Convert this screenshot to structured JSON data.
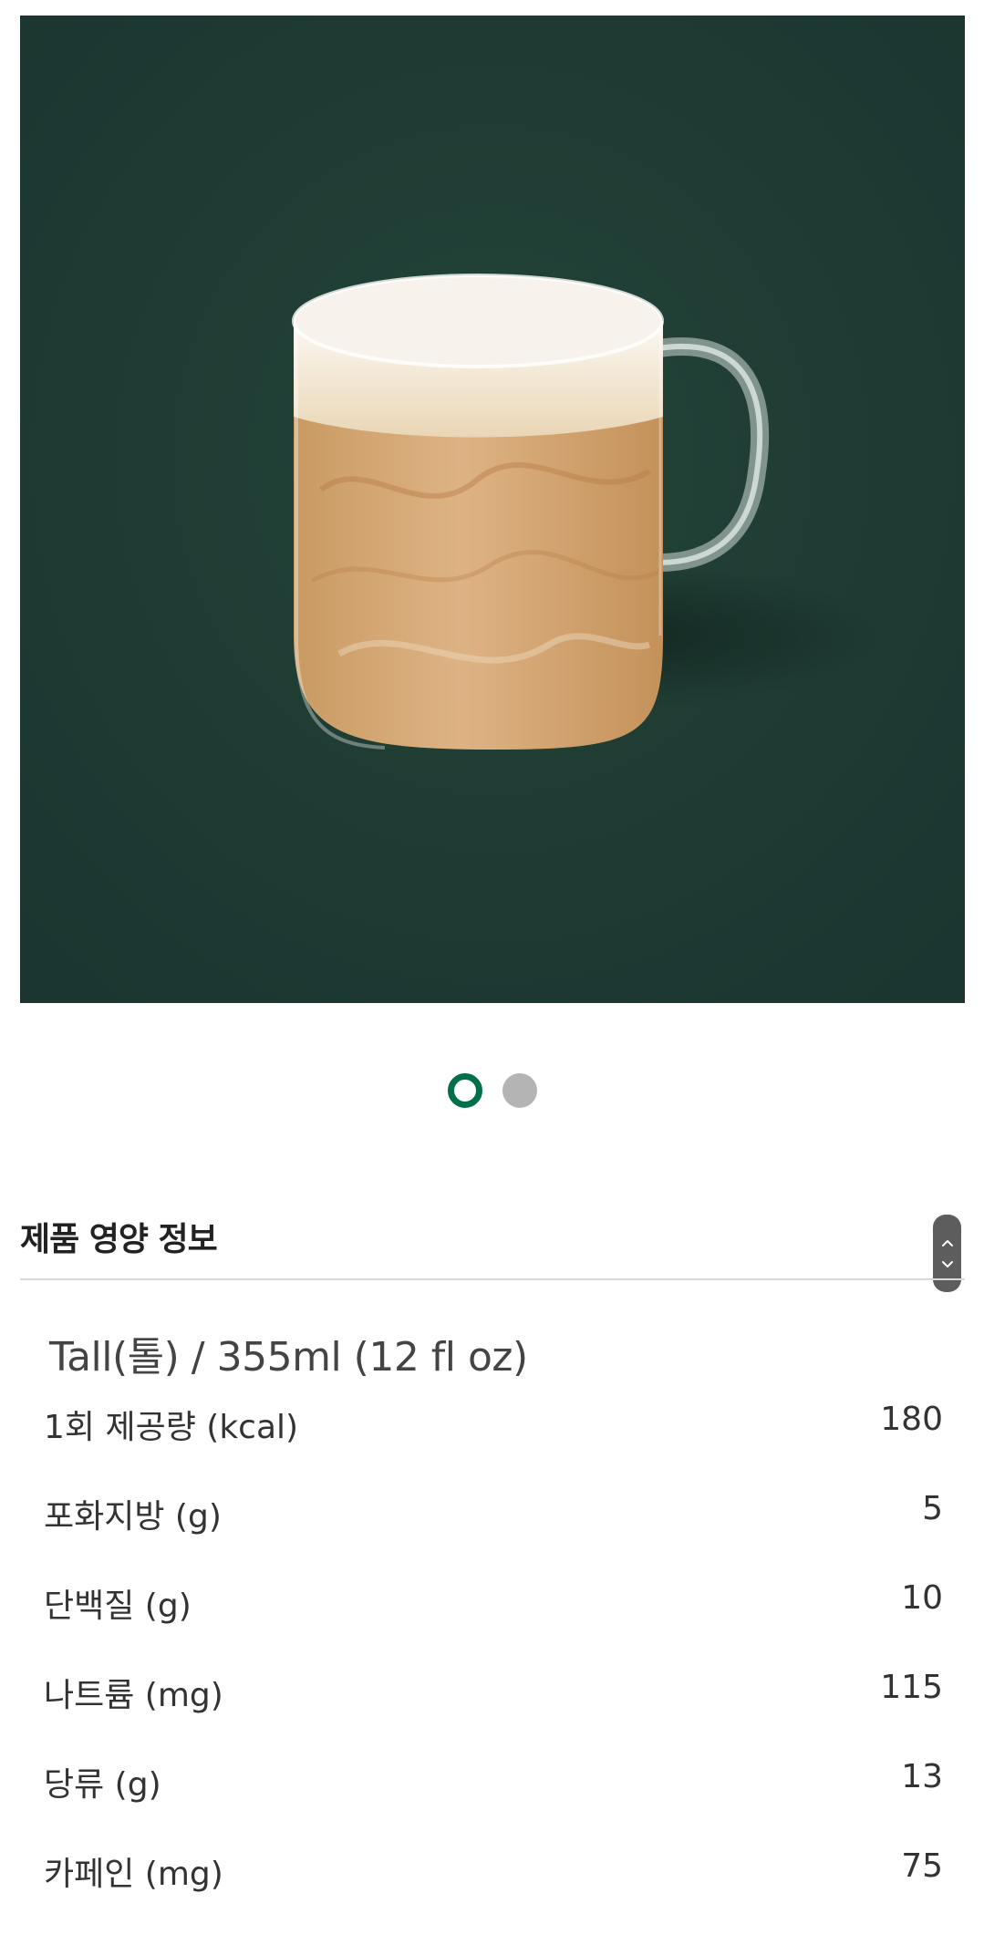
{
  "product": {
    "image_label": "drink-photo",
    "image_alt": "Latte in glass mug"
  },
  "carousel": {
    "active_index": 0,
    "total": 2,
    "active_color": "#00704a",
    "inactive_color": "#b4b4b4"
  },
  "nutrition": {
    "section_title": "제품 영양 정보",
    "size_label": "Tall(톨) / 355ml (12 fl oz)",
    "rows": [
      {
        "label": "1회 제공량 (kcal)",
        "value": "180"
      },
      {
        "label": "포화지방 (g)",
        "value": "5"
      },
      {
        "label": "단백질 (g)",
        "value": "10"
      },
      {
        "label": "나트륨 (mg)",
        "value": "115"
      },
      {
        "label": "당류 (g)",
        "value": "13"
      },
      {
        "label": "카페인 (mg)",
        "value": "75"
      }
    ]
  },
  "colors": {
    "hero_background": "#1e3a32",
    "accent": "#00704a"
  }
}
